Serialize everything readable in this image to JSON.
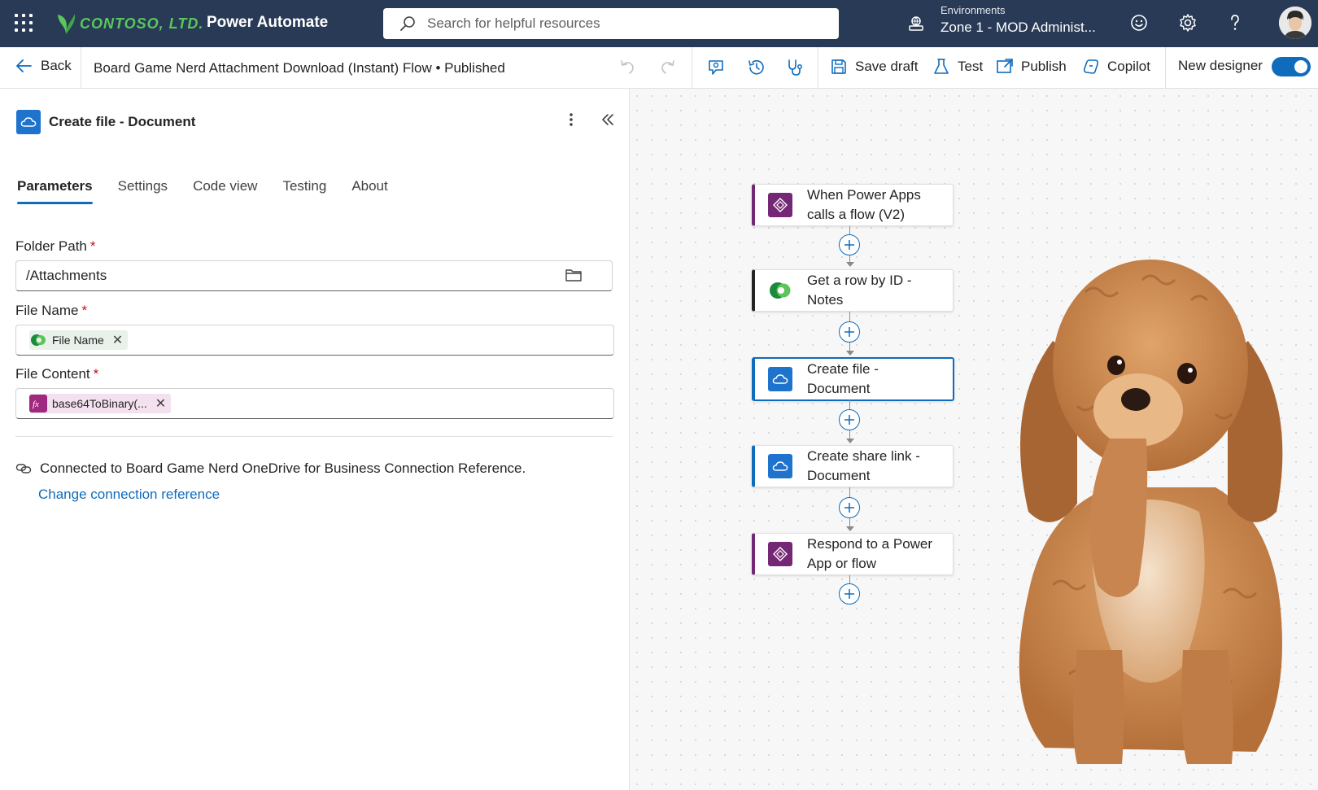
{
  "suite": {
    "brand": "CONTOSO, LTD.",
    "app_title": "Power Automate",
    "search_placeholder": "Search for helpful resources",
    "environment_label": "Environments",
    "environment_value": "Zone 1 - MOD Administ..."
  },
  "command_bar": {
    "back": "Back",
    "flow_title": "Board Game Nerd Attachment Download (Instant) Flow • Published",
    "save_draft": "Save draft",
    "test": "Test",
    "publish": "Publish",
    "copilot": "Copilot",
    "new_designer": "New designer",
    "new_designer_on": true
  },
  "panel": {
    "title": "Create file - Document",
    "tabs": [
      "Parameters",
      "Settings",
      "Code view",
      "Testing",
      "About"
    ],
    "active_tab": "Parameters",
    "fields": {
      "folder_path": {
        "label": "Folder Path",
        "required": "*",
        "value": "/Attachments"
      },
      "file_name": {
        "label": "File Name",
        "required": "*",
        "token": "File Name"
      },
      "file_content": {
        "label": "File Content",
        "required": "*",
        "token": "base64ToBinary(..."
      }
    },
    "connection_text": "Connected to Board Game Nerd OneDrive for Business Connection Reference.",
    "change_connection": "Change connection reference"
  },
  "flow": {
    "steps": [
      {
        "label": "When Power Apps calls a flow (V2)",
        "icon": "power-apps-icon",
        "accent": "#742774"
      },
      {
        "label": "Get a row by ID - Notes",
        "icon": "dataverse-icon",
        "accent": "#242424"
      },
      {
        "label": "Create file - Document",
        "icon": "onedrive-icon",
        "accent": "#0f6cbd",
        "selected": true
      },
      {
        "label": "Create share link - Document",
        "icon": "onedrive-icon",
        "accent": "#0f6cbd"
      },
      {
        "label": "Respond to a Power App or flow",
        "icon": "power-apps-icon",
        "accent": "#742774"
      }
    ]
  },
  "colors": {
    "suite_bar": "#283a56",
    "accent": "#0f6cbd",
    "power_apps": "#742774",
    "brand_green": "#58c75c"
  }
}
